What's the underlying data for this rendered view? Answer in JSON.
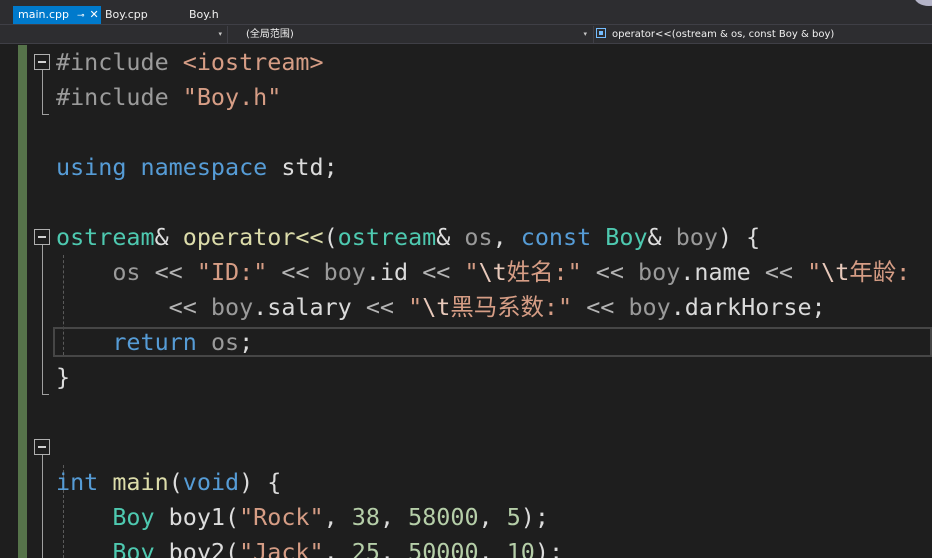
{
  "tabs": [
    {
      "label": "main.cpp",
      "pin": "⊸",
      "close": "✕",
      "active": true
    },
    {
      "label": "Boy.cpp",
      "active": false
    },
    {
      "label": "Boy.h",
      "active": false
    }
  ],
  "nav": {
    "project_arrow": "▾",
    "scope": "(全局范围)",
    "scope_arrow": "▾",
    "member": "operator<<(ostream & os, const Boy & boy)"
  },
  "code": [
    [
      {
        "t": "#include ",
        "c": "pp"
      },
      {
        "t": "<iostream>",
        "c": "str"
      }
    ],
    [
      {
        "t": "#include ",
        "c": "pp"
      },
      {
        "t": "\"Boy.h\"",
        "c": "str"
      }
    ],
    [],
    [
      {
        "t": "using",
        "c": "kw"
      },
      {
        "t": " "
      },
      {
        "t": "namespace",
        "c": "kw"
      },
      {
        "t": " std;"
      }
    ],
    [],
    [
      {
        "t": "ostream",
        "c": "typ"
      },
      {
        "t": "& "
      },
      {
        "t": "operator<<",
        "c": "fn"
      },
      {
        "t": "("
      },
      {
        "t": "ostream",
        "c": "typ"
      },
      {
        "t": "& "
      },
      {
        "t": "os",
        "c": "prm"
      },
      {
        "t": ", "
      },
      {
        "t": "const",
        "c": "kw"
      },
      {
        "t": " "
      },
      {
        "t": "Boy",
        "c": "typ"
      },
      {
        "t": "& "
      },
      {
        "t": "boy",
        "c": "prm"
      },
      {
        "t": ") {"
      }
    ],
    [
      {
        "t": "    "
      },
      {
        "t": "os",
        "c": "prm"
      },
      {
        "t": " << ",
        "c": "op"
      },
      {
        "t": "\"ID:\"",
        "c": "str"
      },
      {
        "t": " << ",
        "c": "op"
      },
      {
        "t": "boy",
        "c": "prm"
      },
      {
        "t": "."
      },
      {
        "t": "id",
        "c": "mem"
      },
      {
        "t": " << ",
        "c": "op"
      },
      {
        "t": "\"",
        "c": "str"
      },
      {
        "t": "\\t",
        "c": "esc"
      },
      {
        "t": "姓名:\"",
        "c": "str"
      },
      {
        "t": " << ",
        "c": "op"
      },
      {
        "t": "boy",
        "c": "prm"
      },
      {
        "t": "."
      },
      {
        "t": "name",
        "c": "mem"
      },
      {
        "t": " << ",
        "c": "op"
      },
      {
        "t": "\"",
        "c": "str"
      },
      {
        "t": "\\t",
        "c": "esc"
      },
      {
        "t": "年龄:",
        "c": "str"
      }
    ],
    [
      {
        "t": "        "
      },
      {
        "t": "<< ",
        "c": "op"
      },
      {
        "t": "boy",
        "c": "prm"
      },
      {
        "t": "."
      },
      {
        "t": "salary",
        "c": "mem"
      },
      {
        "t": " << ",
        "c": "op"
      },
      {
        "t": "\"",
        "c": "str"
      },
      {
        "t": "\\t",
        "c": "esc"
      },
      {
        "t": "黑马系数:\"",
        "c": "str"
      },
      {
        "t": " << ",
        "c": "op"
      },
      {
        "t": "boy",
        "c": "prm"
      },
      {
        "t": "."
      },
      {
        "t": "darkHorse",
        "c": "mem"
      },
      {
        "t": ";"
      }
    ],
    [
      {
        "t": "    "
      },
      {
        "t": "return",
        "c": "kw"
      },
      {
        "t": " "
      },
      {
        "t": "os",
        "c": "prm"
      },
      {
        "t": ";"
      }
    ],
    [
      {
        "t": "}"
      }
    ],
    [],
    [],
    [
      {
        "t": "int",
        "c": "kw"
      },
      {
        "t": " "
      },
      {
        "t": "main",
        "c": "fn"
      },
      {
        "t": "("
      },
      {
        "t": "void",
        "c": "kw"
      },
      {
        "t": ") {"
      }
    ],
    [
      {
        "t": "    "
      },
      {
        "t": "Boy",
        "c": "typ"
      },
      {
        "t": " boy1("
      },
      {
        "t": "\"Rock\"",
        "c": "str"
      },
      {
        "t": ", "
      },
      {
        "t": "38",
        "c": "num"
      },
      {
        "t": ", "
      },
      {
        "t": "58000",
        "c": "num"
      },
      {
        "t": ", "
      },
      {
        "t": "5",
        "c": "num"
      },
      {
        "t": ");"
      }
    ],
    [
      {
        "t": "    "
      },
      {
        "t": "Boy",
        "c": "typ"
      },
      {
        "t": " boy2("
      },
      {
        "t": "\"Jack\"",
        "c": "str"
      },
      {
        "t": ", "
      },
      {
        "t": "25",
        "c": "num"
      },
      {
        "t": ", "
      },
      {
        "t": "50000",
        "c": "num"
      },
      {
        "t": ", "
      },
      {
        "t": "10",
        "c": "num"
      },
      {
        "t": ");"
      }
    ]
  ],
  "colors": {
    "keyword": "#569cd6",
    "string": "#d69d85",
    "type": "#4ec9b0",
    "function": "#dcdcaa",
    "parameter": "#9a9a9a",
    "number": "#b5cea8",
    "change_marker": "#56734a",
    "active_tab": "#007acc"
  }
}
